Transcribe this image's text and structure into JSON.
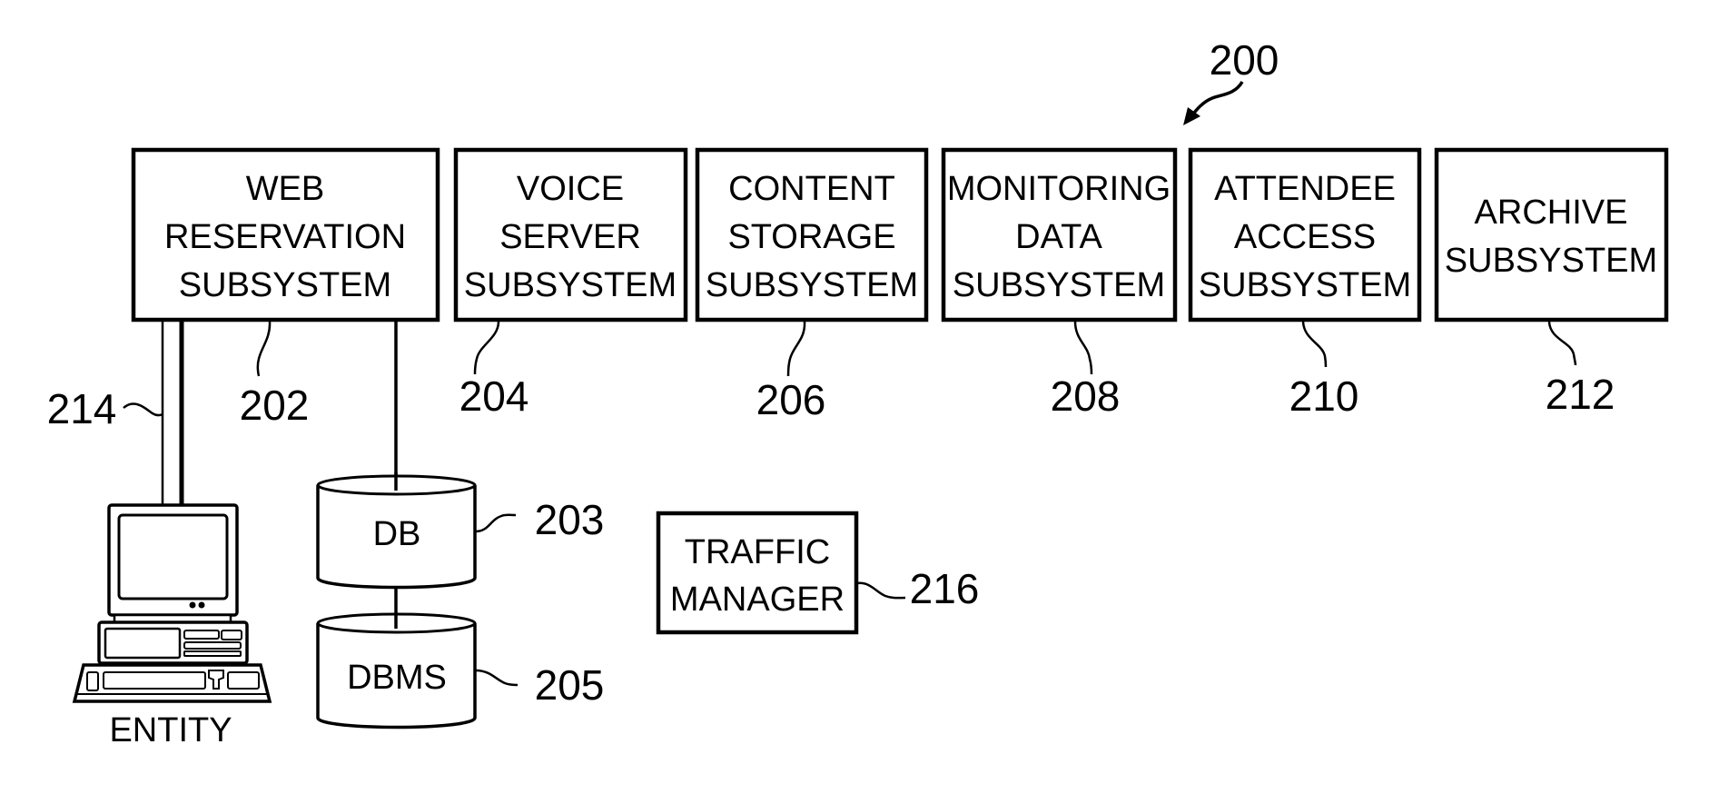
{
  "figure": {
    "reference": "200",
    "title_arrow": "figure-pointer"
  },
  "subsystems": [
    {
      "id": "web-reservation",
      "lines": [
        "WEB",
        "RESERVATION",
        "SUBSYSTEM"
      ],
      "ref": "202"
    },
    {
      "id": "voice-server",
      "lines": [
        "VOICE",
        "SERVER",
        "SUBSYSTEM"
      ],
      "ref": "204"
    },
    {
      "id": "content-storage",
      "lines": [
        "CONTENT",
        "STORAGE",
        "SUBSYSTEM"
      ],
      "ref": "206"
    },
    {
      "id": "monitoring-data",
      "lines": [
        "MONITORING",
        "DATA",
        "SUBSYSTEM"
      ],
      "ref": "208"
    },
    {
      "id": "attendee-access",
      "lines": [
        "ATTENDEE",
        "ACCESS",
        "SUBSYSTEM"
      ],
      "ref": "210"
    },
    {
      "id": "archive",
      "lines": [
        "ARCHIVE",
        "SUBSYSTEM"
      ],
      "ref": "212"
    }
  ],
  "databases": [
    {
      "id": "db",
      "label": "DB",
      "ref": "203"
    },
    {
      "id": "dbms",
      "label": "DBMS",
      "ref": "205"
    }
  ],
  "traffic_manager": {
    "lines": [
      "TRAFFIC",
      "MANAGER"
    ],
    "ref": "216"
  },
  "entity": {
    "label": "ENTITY",
    "icon": "computer-workstation",
    "link_ref": "214"
  },
  "colors": {
    "ink": "#000000",
    "background": "#ffffff"
  }
}
